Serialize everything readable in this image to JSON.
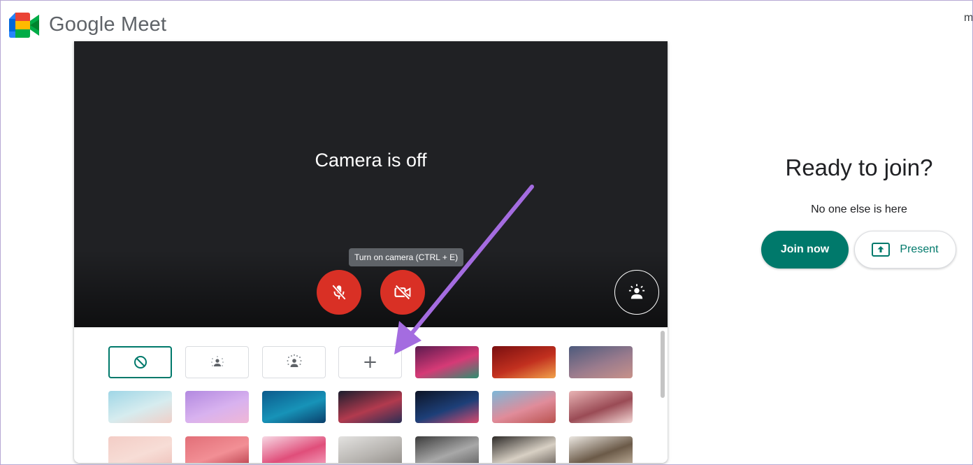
{
  "header": {
    "brand": "Google Meet",
    "corner_text": "m"
  },
  "preview": {
    "camera_status": "Camera is off",
    "tooltip": "Turn on camera (CTRL + E)",
    "mic_state": "off",
    "camera_state": "off"
  },
  "effects": {
    "options": [
      {
        "name": "no-effect",
        "selected": true
      },
      {
        "name": "slight-blur"
      },
      {
        "name": "blur"
      },
      {
        "name": "add-background"
      }
    ],
    "backgrounds": [
      {
        "name": "festive-hall",
        "colors": [
          "#5c1a4f",
          "#d63a76",
          "#2c8f6f"
        ]
      },
      {
        "name": "red-lanterns",
        "colors": [
          "#7a0f10",
          "#c2301f",
          "#f1a24b"
        ]
      },
      {
        "name": "dusk-sky",
        "colors": [
          "#4d5a7c",
          "#9a7b8d",
          "#c8928a"
        ]
      },
      {
        "name": "beach",
        "colors": [
          "#9fd6e6",
          "#d6ecef",
          "#f0cfc8"
        ]
      },
      {
        "name": "pastel-clouds",
        "colors": [
          "#b289e0",
          "#d8b2ef",
          "#f0b7d6"
        ]
      },
      {
        "name": "underwater",
        "colors": [
          "#0b5a8c",
          "#1793b8",
          "#0a3f6b"
        ]
      },
      {
        "name": "nebula",
        "colors": [
          "#1b1e2e",
          "#b23a4e",
          "#2a2f55"
        ]
      },
      {
        "name": "fireworks",
        "colors": [
          "#0d1426",
          "#1d3f78",
          "#d84a6e"
        ]
      },
      {
        "name": "pink-blossoms",
        "colors": [
          "#7db7d8",
          "#e08c9a",
          "#b9524f"
        ]
      },
      {
        "name": "flower-field",
        "colors": [
          "#e8b3b4",
          "#9a4b55",
          "#f3d6d4"
        ]
      },
      {
        "name": "pink-speckle",
        "colors": [
          "#f3cdc6",
          "#f7ddd6",
          "#eec1ba"
        ]
      },
      {
        "name": "red-grid",
        "colors": [
          "#e26f78",
          "#f28f95",
          "#b73b48"
        ]
      },
      {
        "name": "confetti",
        "colors": [
          "#f7d8e4",
          "#e04e7a",
          "#f6a7c2"
        ]
      },
      {
        "name": "white-room",
        "colors": [
          "#e3e2e0",
          "#b7b4b0",
          "#8c8883"
        ]
      },
      {
        "name": "grey-interior",
        "colors": [
          "#3c3c3c",
          "#a8a8a8",
          "#5c5c5c"
        ]
      },
      {
        "name": "sunlit-room",
        "colors": [
          "#2d2a28",
          "#d8d0c4",
          "#5e5650"
        ]
      },
      {
        "name": "bookshelf",
        "colors": [
          "#ece8e2",
          "#6b5a48",
          "#c9b9a4"
        ]
      }
    ]
  },
  "join": {
    "title": "Ready to join?",
    "subtitle": "No one else is here",
    "join_label": "Join now",
    "present_label": "Present",
    "accent": "#00796b"
  }
}
